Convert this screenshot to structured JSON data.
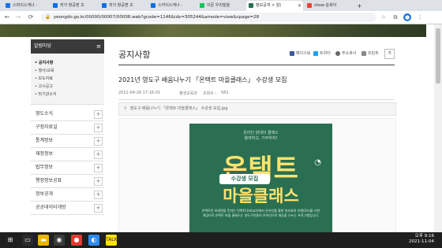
{
  "browser": {
    "tabs": [
      {
        "label": "스마이스캐너 -"
      },
      {
        "label": "저가 항공편 조"
      },
      {
        "label": "저가 항공편 조"
      },
      {
        "label": "스카이스캐너 -"
      },
      {
        "label": "이문 우리말을"
      },
      {
        "label": "정보공개 > 알(",
        "active": true
      },
      {
        "label": "show 순회아"
      }
    ],
    "new_tab": "+",
    "url": "yeongdo.go.kr/00000/00007/00008.web?gcode=1146&idx=305244&amode=view&cpage=28",
    "nav": {
      "back": "←",
      "forward": "→",
      "reload": "⟳"
    },
    "toolbar_icons": [
      "bookmark-star-icon",
      "extension-icon",
      "profile-icon",
      "menu-icon"
    ]
  },
  "sidebar": {
    "header": "알림마당",
    "header_icon": "≡",
    "subitems": [
      {
        "label": "• 공지사항",
        "selected": true
      },
      {
        "label": "• 행사/교육"
      },
      {
        "label": "• 보도자료"
      },
      {
        "label": "• 고시공고"
      },
      {
        "label": "• 타기관소식"
      }
    ],
    "items": [
      {
        "label": "영도소식"
      },
      {
        "label": "구정자료실"
      },
      {
        "label": "통계정보"
      },
      {
        "label": "재정정보"
      },
      {
        "label": "법무정보"
      },
      {
        "label": "행정정보공표"
      },
      {
        "label": "정보공개"
      },
      {
        "label": "공공데이터개방"
      }
    ],
    "plus": "+"
  },
  "main": {
    "page_title": "공지사항",
    "share": {
      "facebook": "페이스북",
      "twitter": "트위터",
      "copy_url": "주소복사",
      "print": "프린트"
    },
    "text_size": "가",
    "post_title": "2021년 영도구 배움나누기 「온택트 마을클래스」 수강생 모집",
    "meta": {
      "date": "2021-04-26 17:16:01",
      "dept": "평생교육과",
      "views_label": "조회수 :",
      "views": "581"
    },
    "attachment": "영도구 배움나누기 「온택트 마을클래스」 수강생 모집.jpg",
    "poster": {
      "line1": "온라인 원데이 클래스",
      "line2": "참여하고, 기부하자!",
      "big": "온택트",
      "badge": "수강생 모집",
      "big2": "마을클래스",
      "desc": "온택트란 비대면을 뜻하는 언택트(Untact)에서 온라인을 통한 외부와의 연결(On)을 더한 개념으로 온택트 마을 클래스는 영도구민들이 온라인으로 재능을 나누는 프로그램입니다."
    }
  },
  "taskbar": {
    "start_icon": "windows-start-icon",
    "time": "오후 9:16",
    "date": "2021-11-04"
  },
  "colors": {
    "sidebar_header": "#3a3a3a",
    "poster_bg": "#2a6f52",
    "poster_accent": "#ffe36e",
    "taskbar": "#1f1f1f",
    "chrome_tab_bg": "#dee1e6"
  }
}
